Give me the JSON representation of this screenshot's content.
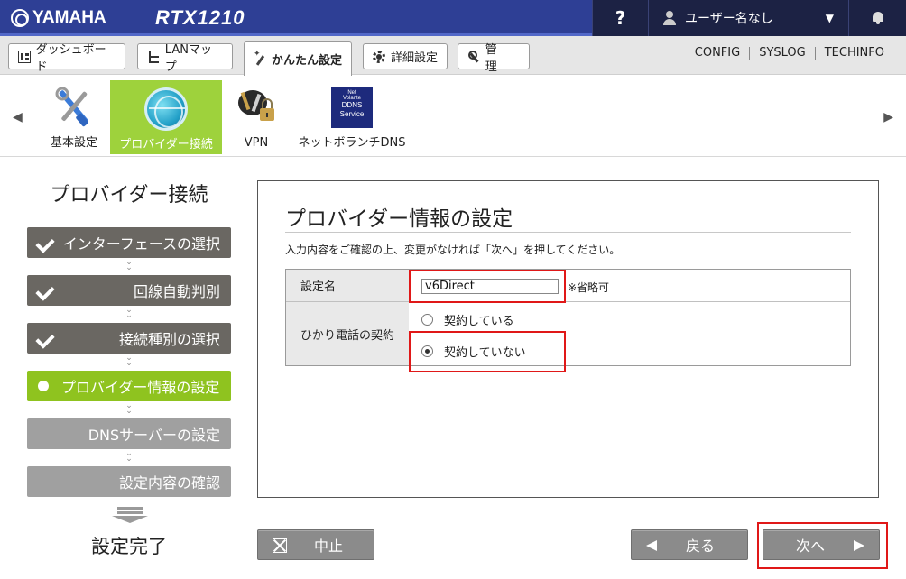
{
  "header": {
    "brand": "YAMAHA",
    "model": "RTX1210",
    "help_label": "?",
    "user_label": "ユーザー名なし"
  },
  "nav": {
    "tabs": [
      {
        "label": "ダッシュボード",
        "icon": "dashboard-icon"
      },
      {
        "label": "LANマップ",
        "icon": "lan-map-icon"
      },
      {
        "label": "かんたん設定",
        "icon": "wizard-icon",
        "active": true
      },
      {
        "label": "詳細設定",
        "icon": "gear-icon"
      },
      {
        "label": "管　理",
        "icon": "wrench-icon"
      }
    ],
    "links": [
      "CONFIG",
      "SYSLOG",
      "TECHINFO"
    ]
  },
  "strip": {
    "items": [
      {
        "label": "基本設定",
        "icon": "tools-icon"
      },
      {
        "label": "プロバイダー接続",
        "icon": "globe-icon",
        "selected": true
      },
      {
        "label": "VPN",
        "icon": "vpn-keys-icon"
      },
      {
        "label": "ネットボランチDNS",
        "icon": "ddns-icon",
        "icon_text": [
          "Net",
          "Volante",
          "DDNS",
          "Service"
        ]
      }
    ]
  },
  "steps": {
    "title": "プロバイダー接続",
    "items": [
      {
        "label": "インターフェースの選択",
        "state": "done"
      },
      {
        "label": "回線自動判別",
        "state": "done"
      },
      {
        "label": "接続種別の選択",
        "state": "done"
      },
      {
        "label": "プロバイダー情報の設定",
        "state": "current"
      },
      {
        "label": "DNSサーバーの設定",
        "state": "todo"
      },
      {
        "label": "設定内容の確認",
        "state": "todo"
      }
    ],
    "complete": "設定完了"
  },
  "panel": {
    "title": "プロバイダー情報の設定",
    "instruction": "入力内容をご確認の上、変更がなければ「次へ」を押してください。",
    "setting_name_label": "設定名",
    "setting_name_value": "v6Direct",
    "setting_name_note": "※省略可",
    "hikari_label": "ひかり電話の契約",
    "radio_options": [
      {
        "label": "契約している",
        "checked": false
      },
      {
        "label": "契約していない",
        "checked": true
      }
    ]
  },
  "buttons": {
    "cancel": "中止",
    "back": "戻る",
    "next": "次へ"
  },
  "colors": {
    "header_bg": "#2e3f95",
    "header_dark": "#1c2244",
    "accent_green": "#8fc31f",
    "step_done": "#6a6762",
    "step_todo": "#a0a0a0",
    "button_gray": "#8b8b8b",
    "highlight_red": "#e01818"
  }
}
